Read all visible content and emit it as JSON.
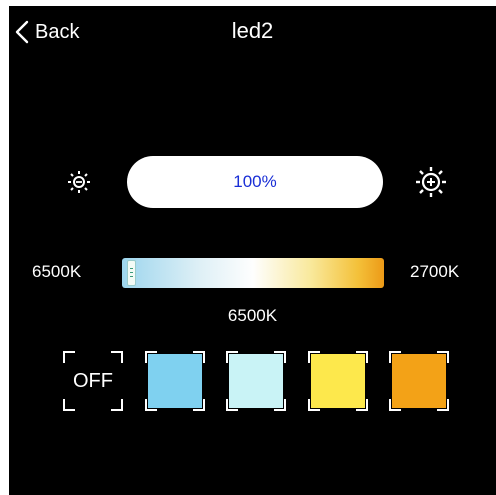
{
  "header": {
    "back_label": "Back",
    "title": "led2"
  },
  "brightness": {
    "value": "100%",
    "level_percent": 100,
    "value_color": "#1a2fd6",
    "decrease_icon": "sun-dim-icon",
    "increase_icon": "sun-bright-icon"
  },
  "color_temperature": {
    "min_label": "6500K",
    "max_label": "2700K",
    "current": "6500K",
    "handle_position": 0
  },
  "presets": [
    {
      "label": "OFF",
      "color": "#000000"
    },
    {
      "label": "",
      "color": "#7fd1f0"
    },
    {
      "label": "",
      "color": "#c9f3f6"
    },
    {
      "label": "",
      "color": "#fde84c"
    },
    {
      "label": "",
      "color": "#f3a217"
    }
  ]
}
